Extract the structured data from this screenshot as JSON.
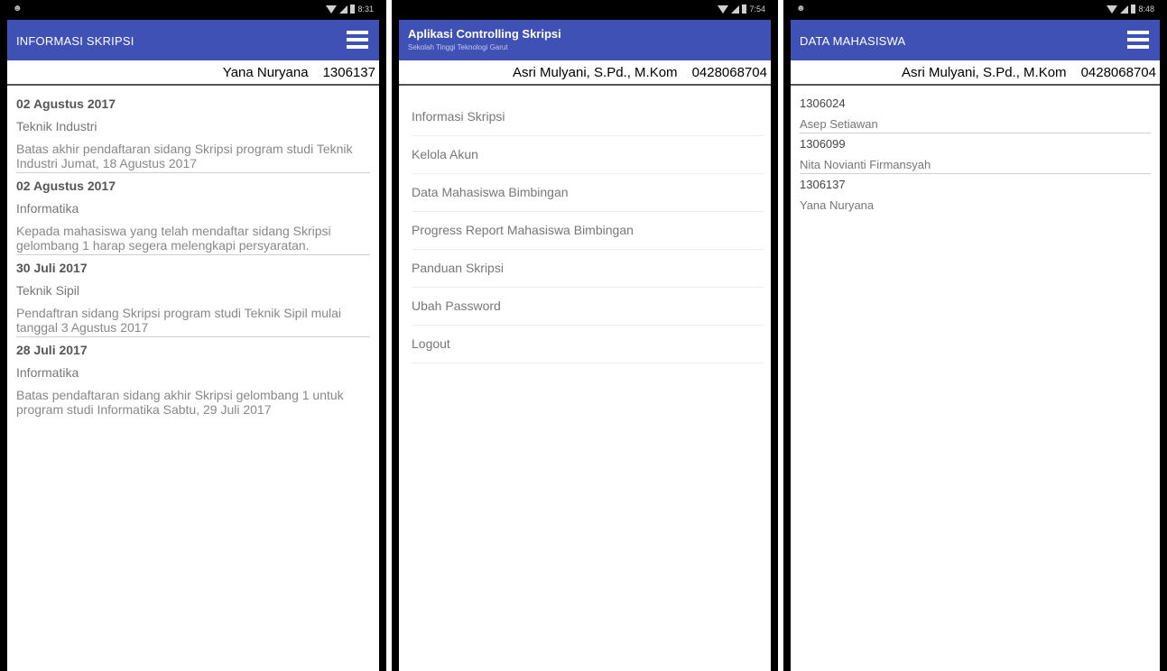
{
  "panel1": {
    "status_time": "8:31",
    "title": "INFORMASI SKRIPSI",
    "user_name": "Yana Nuryana",
    "user_id": "1306137",
    "news": [
      {
        "date": "02 Agustus 2017",
        "dept": "Teknik Industri",
        "desc": "Batas akhir pendaftaran sidang Skripsi program studi Teknik Industri Jumat, 18 Agustus 2017"
      },
      {
        "date": "02 Agustus 2017",
        "dept": "Informatika",
        "desc": "Kepada mahasiswa yang telah mendaftar sidang Skripsi gelombang 1 harap segera melengkapi persyaratan."
      },
      {
        "date": "30 Juli 2017",
        "dept": "Teknik Sipil",
        "desc": "Pendaftran sidang Skripsi program studi Teknik Sipil mulai tanggal 3 Agustus 2017"
      },
      {
        "date": "28 Juli 2017",
        "dept": "Informatika",
        "desc": "Batas pendaftaran sidang akhir Skripsi gelombang 1 untuk program studi Informatika Sabtu, 29 Juli 2017"
      }
    ]
  },
  "panel2": {
    "status_time": "7:54",
    "title": "Aplikasi Controlling Skripsi",
    "subtitle": "Sekolah Tinggi Teknologi Garut",
    "user_name": "Asri Mulyani, S.Pd., M.Kom",
    "user_id": "0428068704",
    "menu": [
      "Informasi Skripsi",
      "Kelola Akun",
      "Data Mahasiswa Bimbingan",
      "Progress Report Mahasiswa Bimbingan",
      "Panduan Skripsi",
      "Ubah Password",
      "Logout"
    ]
  },
  "panel3": {
    "status_time": "8:48",
    "title": "DATA MAHASISWA",
    "user_name": "Asri Mulyani, S.Pd., M.Kom",
    "user_id": "0428068704",
    "students": [
      {
        "id": "1306024",
        "name": "Asep Setiawan"
      },
      {
        "id": "1306099",
        "name": "Nita Novianti Firmansyah"
      },
      {
        "id": "1306137",
        "name": "Yana Nuryana"
      }
    ]
  },
  "colors": {
    "appbar": "#3f51b5",
    "statusbar": "#000000"
  },
  "icons": {
    "menu": "hamburger-menu-icon",
    "wifi": "wifi-icon",
    "signal": "signal-icon",
    "battery": "battery-icon",
    "notification": "android-notification-icon"
  }
}
